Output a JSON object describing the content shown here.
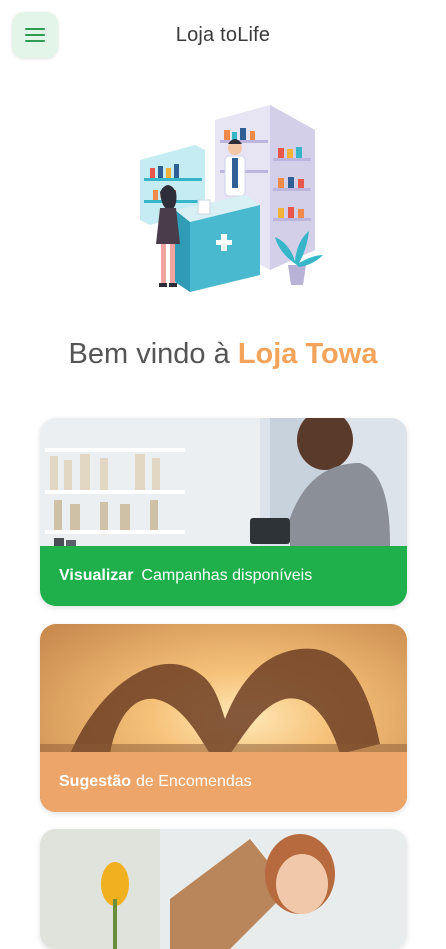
{
  "header": {
    "title": "Loja toLife",
    "menu_icon": "hamburger-menu-icon"
  },
  "colors": {
    "accent_green": "#1fb04c",
    "accent_orange": "#f4a35a",
    "menu_bg": "#e2f5e8"
  },
  "welcome": {
    "prefix": "Bem vindo à ",
    "brand": "Loja Towa"
  },
  "cards": [
    {
      "strong": "Visualizar",
      "text": "Campanhas disponíveis"
    },
    {
      "strong": "Sugestão",
      "text": "de Encomendas"
    }
  ]
}
